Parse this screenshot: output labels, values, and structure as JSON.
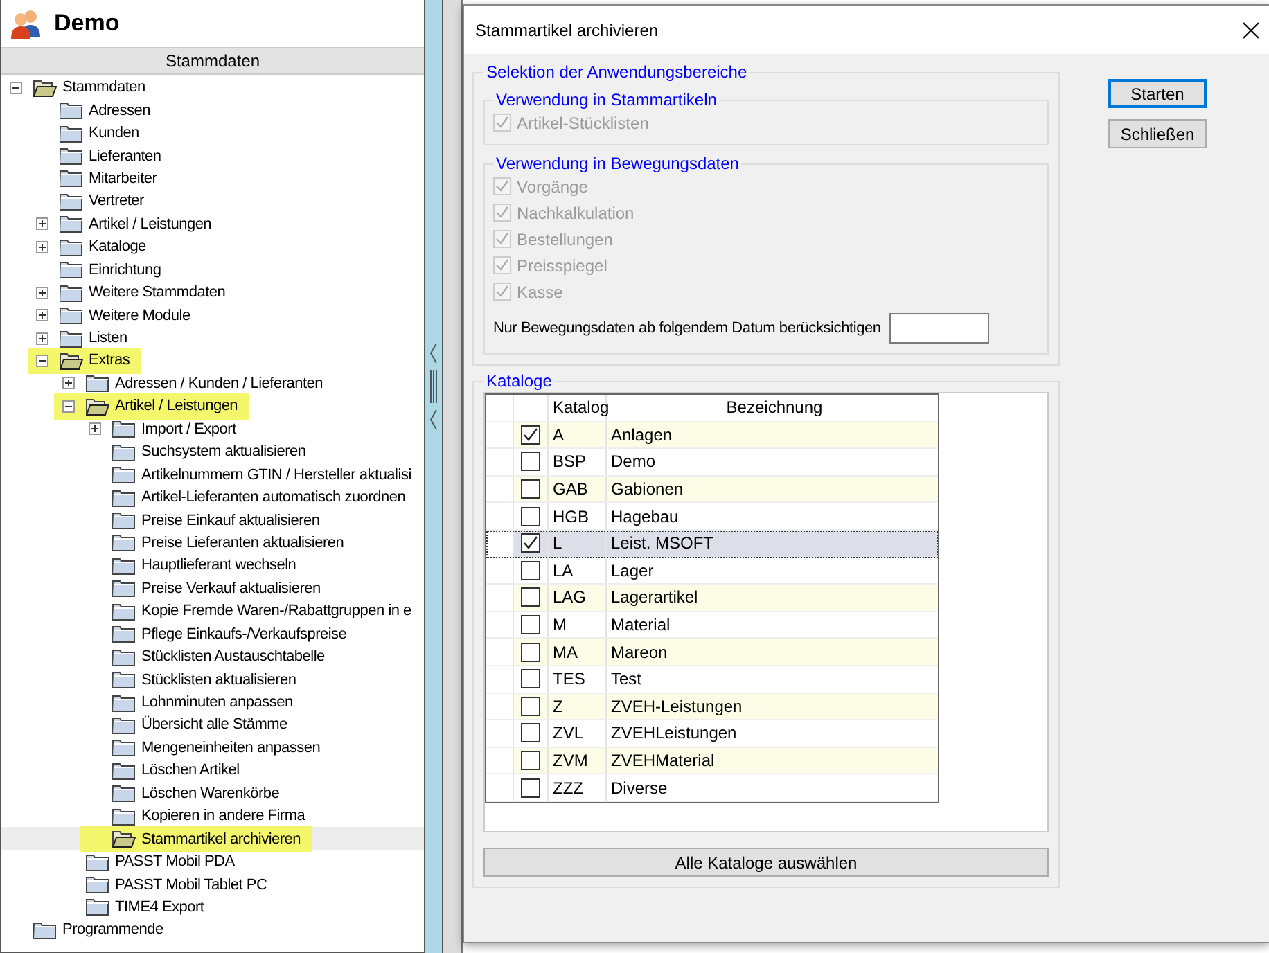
{
  "app": {
    "title": "Demo"
  },
  "sidebar": {
    "header": "Stammdaten",
    "tree": [
      {
        "label": "Stammdaten",
        "expanded": true,
        "selected": false,
        "highlighted": false,
        "children": [
          {
            "label": "Adressen",
            "selected": false,
            "highlighted": false
          },
          {
            "label": "Kunden",
            "selected": false,
            "highlighted": false
          },
          {
            "label": "Lieferanten",
            "selected": false,
            "highlighted": false
          },
          {
            "label": "Mitarbeiter",
            "selected": false,
            "highlighted": false
          },
          {
            "label": "Vertreter",
            "selected": false,
            "highlighted": false
          },
          {
            "label": "Artikel / Leistungen",
            "expanded": false,
            "selected": false,
            "highlighted": false
          },
          {
            "label": "Kataloge",
            "expanded": false,
            "selected": false,
            "highlighted": false
          },
          {
            "label": "Einrichtung",
            "selected": false,
            "highlighted": false
          },
          {
            "label": "Weitere Stammdaten",
            "expanded": false,
            "selected": false,
            "highlighted": false
          },
          {
            "label": "Weitere Module",
            "expanded": false,
            "selected": false,
            "highlighted": false
          },
          {
            "label": "Listen",
            "expanded": false,
            "selected": false,
            "highlighted": false
          },
          {
            "label": "Extras",
            "expanded": true,
            "selected": false,
            "highlighted": true,
            "children": [
              {
                "label": "Adressen / Kunden / Lieferanten",
                "expanded": false,
                "selected": false,
                "highlighted": false
              },
              {
                "label": "Artikel / Leistungen",
                "expanded": true,
                "selected": false,
                "highlighted": true,
                "children": [
                  {
                    "label": "Import / Export",
                    "expanded": false,
                    "selected": false,
                    "highlighted": false
                  },
                  {
                    "label": "Suchsystem aktualisieren",
                    "selected": false,
                    "highlighted": false
                  },
                  {
                    "label": "Artikelnummern GTIN / Hersteller aktualisi",
                    "selected": false,
                    "highlighted": false
                  },
                  {
                    "label": "Artikel-Lieferanten automatisch zuordnen",
                    "selected": false,
                    "highlighted": false
                  },
                  {
                    "label": "Preise Einkauf aktualisieren",
                    "selected": false,
                    "highlighted": false
                  },
                  {
                    "label": "Preise Lieferanten aktualisieren",
                    "selected": false,
                    "highlighted": false
                  },
                  {
                    "label": "Hauptlieferant wechseln",
                    "selected": false,
                    "highlighted": false
                  },
                  {
                    "label": "Preise Verkauf aktualisieren",
                    "selected": false,
                    "highlighted": false
                  },
                  {
                    "label": "Kopie Fremde Waren-/Rabattgruppen in e",
                    "selected": false,
                    "highlighted": false
                  },
                  {
                    "label": "Pflege Einkaufs-/Verkaufspreise",
                    "selected": false,
                    "highlighted": false
                  },
                  {
                    "label": "Stücklisten Austauschtabelle",
                    "selected": false,
                    "highlighted": false
                  },
                  {
                    "label": "Stücklisten aktualisieren",
                    "selected": false,
                    "highlighted": false
                  },
                  {
                    "label": "Lohnminuten anpassen",
                    "selected": false,
                    "highlighted": false
                  },
                  {
                    "label": "Übersicht alle Stämme",
                    "selected": false,
                    "highlighted": false
                  },
                  {
                    "label": "Mengeneinheiten anpassen",
                    "selected": false,
                    "highlighted": false
                  },
                  {
                    "label": "Löschen Artikel",
                    "selected": false,
                    "highlighted": false
                  },
                  {
                    "label": "Löschen Warenkörbe",
                    "selected": false,
                    "highlighted": false
                  },
                  {
                    "label": "Kopieren in andere Firma",
                    "selected": false,
                    "highlighted": false
                  },
                  {
                    "label": "Stammartikel archivieren",
                    "selected": true,
                    "highlighted": true
                  }
                ]
              },
              {
                "label": "PASST Mobil PDA",
                "selected": false,
                "highlighted": false
              },
              {
                "label": "PASST Mobil Tablet PC",
                "selected": false,
                "highlighted": false
              },
              {
                "label": "TIME4 Export",
                "selected": false,
                "highlighted": false
              }
            ]
          }
        ]
      },
      {
        "label": "Programmende",
        "selected": false,
        "highlighted": false
      }
    ]
  },
  "dialog": {
    "title": "Stammartikel archivieren",
    "selection": {
      "title": "Selektion der Anwendungsbereiche",
      "groups": [
        {
          "title": "Verwendung in Stammartikeln",
          "options": [
            {
              "label": "Artikel-Stücklisten",
              "checked": true,
              "disabled": true
            }
          ]
        },
        {
          "title": "Verwendung in Bewegungsdaten",
          "options": [
            {
              "label": "Vorgänge",
              "checked": true,
              "disabled": true
            },
            {
              "label": "Nachkalkulation",
              "checked": true,
              "disabled": true
            },
            {
              "label": "Bestellungen",
              "checked": true,
              "disabled": true
            },
            {
              "label": "Preisspiegel",
              "checked": true,
              "disabled": true
            },
            {
              "label": "Kasse",
              "checked": true,
              "disabled": true
            }
          ],
          "date_filter": {
            "label": "Nur Bewegungsdaten ab folgendem Datum berücksichtigen"
          }
        }
      ]
    },
    "catalogs": {
      "title": "Kataloge",
      "columns": [
        "Katalog",
        "Bezeichnung"
      ],
      "rows": [
        {
          "code": "A",
          "name": "Anlagen",
          "checked": true,
          "selected": false
        },
        {
          "code": "BSP",
          "name": "Demo",
          "checked": false,
          "selected": false
        },
        {
          "code": "GAB",
          "name": "Gabionen",
          "checked": false,
          "selected": false
        },
        {
          "code": "HGB",
          "name": "Hagebau",
          "checked": false,
          "selected": false
        },
        {
          "code": "L",
          "name": "Leist. MSOFT",
          "checked": true,
          "selected": true
        },
        {
          "code": "LA",
          "name": "Lager",
          "checked": false,
          "selected": false
        },
        {
          "code": "LAG",
          "name": "Lagerartikel",
          "checked": false,
          "selected": false
        },
        {
          "code": "M",
          "name": "Material",
          "checked": false,
          "selected": false
        },
        {
          "code": "MA",
          "name": "Mareon",
          "checked": false,
          "selected": false
        },
        {
          "code": "TES",
          "name": "Test",
          "checked": false,
          "selected": false
        },
        {
          "code": "Z",
          "name": "ZVEH-Leistungen",
          "checked": false,
          "selected": false
        },
        {
          "code": "ZVL",
          "name": "ZVEHLeistungen",
          "checked": false,
          "selected": false
        },
        {
          "code": "ZVM",
          "name": "ZVEHMaterial",
          "checked": false,
          "selected": false
        },
        {
          "code": "ZZZ",
          "name": "Diverse",
          "checked": false,
          "selected": false
        }
      ],
      "select_all_button": "Alle Kataloge auswählen"
    },
    "buttons": [
      {
        "label": "Starten",
        "default": true
      },
      {
        "label": "Schließen",
        "default": false
      }
    ]
  }
}
